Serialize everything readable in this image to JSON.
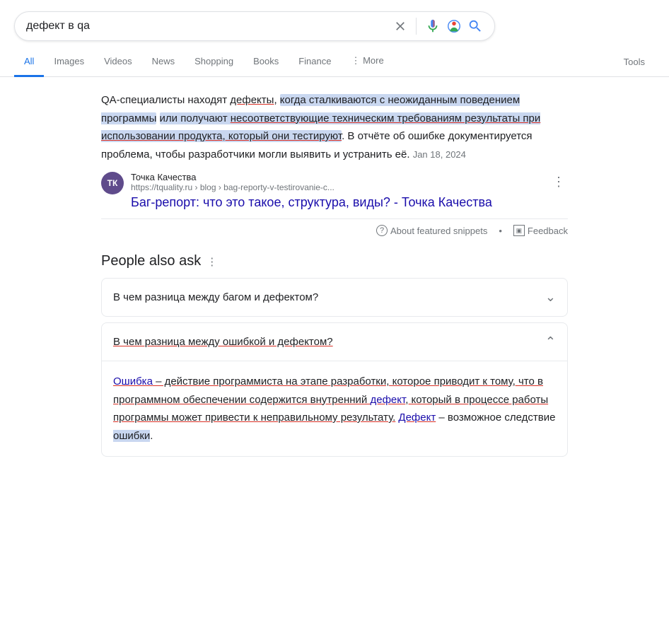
{
  "search": {
    "query": "дефект в qa",
    "placeholder": "дефект в qa",
    "close_label": "×",
    "mic_label": "voice search",
    "lens_label": "search by image",
    "search_label": "search"
  },
  "nav": {
    "tabs": [
      {
        "label": "All",
        "active": true
      },
      {
        "label": "Images",
        "active": false
      },
      {
        "label": "Videos",
        "active": false
      },
      {
        "label": "News",
        "active": false
      },
      {
        "label": "Shopping",
        "active": false
      },
      {
        "label": "Books",
        "active": false
      },
      {
        "label": "Finance",
        "active": false
      },
      {
        "label": "⋮ More",
        "active": false
      }
    ],
    "tools_label": "Tools"
  },
  "featured_snippet": {
    "text_parts": [
      {
        "text": "QA-специалисты находят ",
        "type": "normal"
      },
      {
        "text": "дефекты",
        "type": "underline-red"
      },
      {
        "text": ", когда сталкиваются с неожиданным поведением программы",
        "type": "highlight-blue"
      },
      {
        "text": " или получают несоответствующие техническим требованиям результаты при использовании продукта, который они тестируют",
        "type": "highlight-blue underline-red"
      },
      {
        "text": ". В отчёте об ошибке документируется проблема, чтобы разработчики могли выявить и устранить её.",
        "type": "normal"
      },
      {
        "text": " Jan 18, 2024",
        "type": "date"
      }
    ],
    "source": {
      "favicon_text": "ТК",
      "favicon_color": "#5f4b8b",
      "name": "Точка Качества",
      "url": "https://tquality.ru › blog › bag-reporty-v-testirovanie-c...",
      "title": "Баг-репорт: что это такое, структура, виды? - Точка Качества",
      "menu_label": "⋮"
    },
    "footer": {
      "about_label": "About featured snippets",
      "feedback_label": "Feedback",
      "question_icon": "?"
    }
  },
  "people_also_ask": {
    "title": "People also ask",
    "menu_label": "⋮",
    "items": [
      {
        "question": "В чем разница между багом и дефектом?",
        "expanded": false,
        "answer": ""
      },
      {
        "question": "В чем разница между ошибкой и дефектом?",
        "expanded": true,
        "answer_html": "answer-expanded"
      }
    ]
  },
  "paa_answer": {
    "parts": [
      {
        "text": "Ошибка",
        "type": "link"
      },
      {
        "text": " – действие программиста на этапе разработки, которое приводит к тому, что в программном обеспечении содержится внутренний ",
        "type": "normal underline-red-bg"
      },
      {
        "text": "дефект",
        "type": "link"
      },
      {
        "text": ", который в процессе работы программы может привести к неправильному результату.",
        "type": "normal underline-red-bg"
      },
      {
        "text": " ",
        "type": "normal"
      },
      {
        "text": "Дефект",
        "type": "link underline-red"
      },
      {
        "text": " – возможное следствие ",
        "type": "normal"
      },
      {
        "text": "ошибки",
        "type": "highlight"
      },
      {
        "text": ".",
        "type": "normal"
      }
    ]
  }
}
